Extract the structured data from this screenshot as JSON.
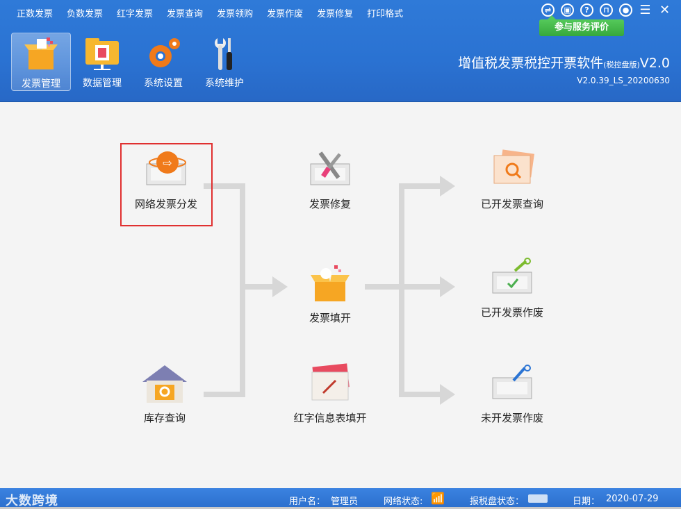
{
  "menu": [
    "正数发票",
    "负数发票",
    "红字发票",
    "发票查询",
    "发票领购",
    "发票作废",
    "发票修复",
    "打印格式"
  ],
  "window_controls": [
    "swap-icon",
    "clipboard-icon",
    "help-icon",
    "lock-icon",
    "user-icon",
    "menu-icon",
    "close-icon"
  ],
  "feedback_button": "参与服务评价",
  "toolbar": [
    {
      "label": "发票管理",
      "icon": "invoice-box-icon",
      "active": true
    },
    {
      "label": "数据管理",
      "icon": "data-folder-icon",
      "active": false
    },
    {
      "label": "系统设置",
      "icon": "gears-icon",
      "active": false
    },
    {
      "label": "系统维护",
      "icon": "tools-icon",
      "active": false
    }
  ],
  "brand": {
    "title": "增值税发票税控开票软件",
    "edition": "(税控盘版)",
    "version_suffix": "V2.0",
    "build": "V2.0.39_LS_20200630"
  },
  "flow": {
    "network_dispatch": "网络发票分发",
    "repair": "发票修复",
    "issued_query": "已开发票查询",
    "fill_issue": "发票填开",
    "issued_void": "已开发票作废",
    "stock_query": "库存查询",
    "red_info": "红字信息表填开",
    "unissued_void": "未开发票作废"
  },
  "status": {
    "logo": "大数跨境",
    "user_label": "用户名：",
    "user_value": "管理员",
    "network_label": "网络状态:",
    "disk_label": "报税盘状态：",
    "date_label": "日期：",
    "date_value": "2020-07-29"
  },
  "colors": {
    "header": "#2b74d4",
    "accent_green": "#3fb044",
    "highlight": "#e03030",
    "arrow": "#d7d7d7"
  }
}
